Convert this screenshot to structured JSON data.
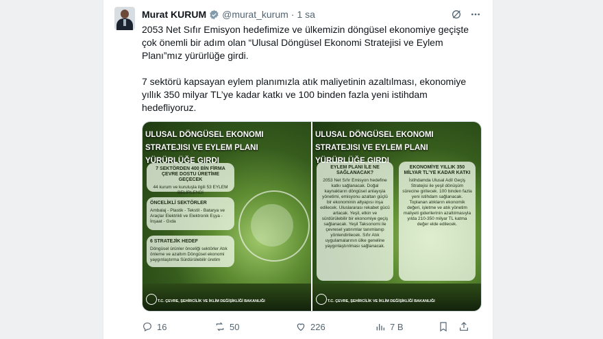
{
  "tweet": {
    "author_name": "Murat KURUM",
    "handle": "@murat_kurum",
    "separator": "·",
    "time": "1 sa",
    "paragraph1": "2053 Net Sıfır Emisyon hedefimize ve ülkemizin döngüsel ekonomiye geçişte çok önemli bir adım olan “Ulusal Döngüsel Ekonomi Stratejisi ve Eylem Planı”mız yürürlüğe girdi.",
    "paragraph2": "7 sektörü kapsayan eylem planımızla atık maliyetinin azaltılması, ekonomiye yıllık 350 milyar TL’ye kadar katkı ve 100 binden fazla yeni istihdam hedefliyoruz."
  },
  "media": {
    "title": "Ulusal Döngüsel Ekonomi Stratejisi ve Eylem Planı Yürürlüğe Girdi",
    "left": {
      "box1_title": "7 SEKTÖRDEN 400 BİN FİRMA ÇEVRE DOSTU ÜRETİME GEÇECEK",
      "box1_body": "44 kurum ve kuruluşla ilgili 53 EYLEM BELİRLENDİ",
      "box2_title": "ÖNCELİKLİ SEKTÖRLER",
      "box2_body": "Ambalaj - Plastik - Tekstil - Batarya ve Araçlar Elektrikli ve Elektronik Eşya - İnşaat - Gıda",
      "box3_title": "6 STRATEJİK HEDEF",
      "box3_body": "Döngüsel ürünler önceliği sektörler Atık önleme ve azaltım Döngüsel ekonomi yaygınlaştırma Sürdürülebilir üretim"
    },
    "right": {
      "box1_title": "EYLEM PLANI İLE NE SAĞLANACAK?",
      "box1_body": "2053 Net Sıfır Emisyon hedefine katkı sağlanacak. Doğal kaynakların döngüsel anlayışla yönetimi, emisyonu azaltan güçlü bir ekonominin altyapısı inşa edilecek. Uluslararası rekabet gücü artacak. Yeşil, etkin ve sürdürülebilir bir ekonomiye geçiş sağlanacak. Yeşil Taksonomi ile çevresel yatırımlar tanımlanıp yönlendirilecek. Sıfır Atık uygulamalarının ülke geneline yaygınlaştırılması sağlanacak.",
      "box2_title": "EKONOMİYE YILLIK 350 MİLYAR TL’YE KADAR KATKI",
      "box2_body": "İstihdamda Ulusal Adil Geçiş Stratejisi ile yeşil dönüşüm sürecine girilecek. 100 binden fazla yeni istihdam sağlanacak. Toplanan atıkların ekonomik değeri, işletme ve atık yönetim maliyeti giderilerinin azaltılmasıyla yılda 210-350 milyar TL katma değer elde edilecek."
    },
    "ministry": "T.C. ÇEVRE, ŞEHİRCİLİK VE İKLİM DEĞİŞİKLİĞİ BAKANLIĞI"
  },
  "actions": {
    "replies": "16",
    "reposts": "50",
    "likes": "226",
    "views": "7 B"
  },
  "colors": {
    "text": "#0f1419",
    "secondary": "#536471",
    "verified": "#829aab"
  },
  "icons": [
    "verified-badge-icon",
    "grok-icon",
    "more-icon",
    "reply-icon",
    "repost-icon",
    "like-icon",
    "views-icon",
    "bookmark-icon",
    "share-icon"
  ]
}
